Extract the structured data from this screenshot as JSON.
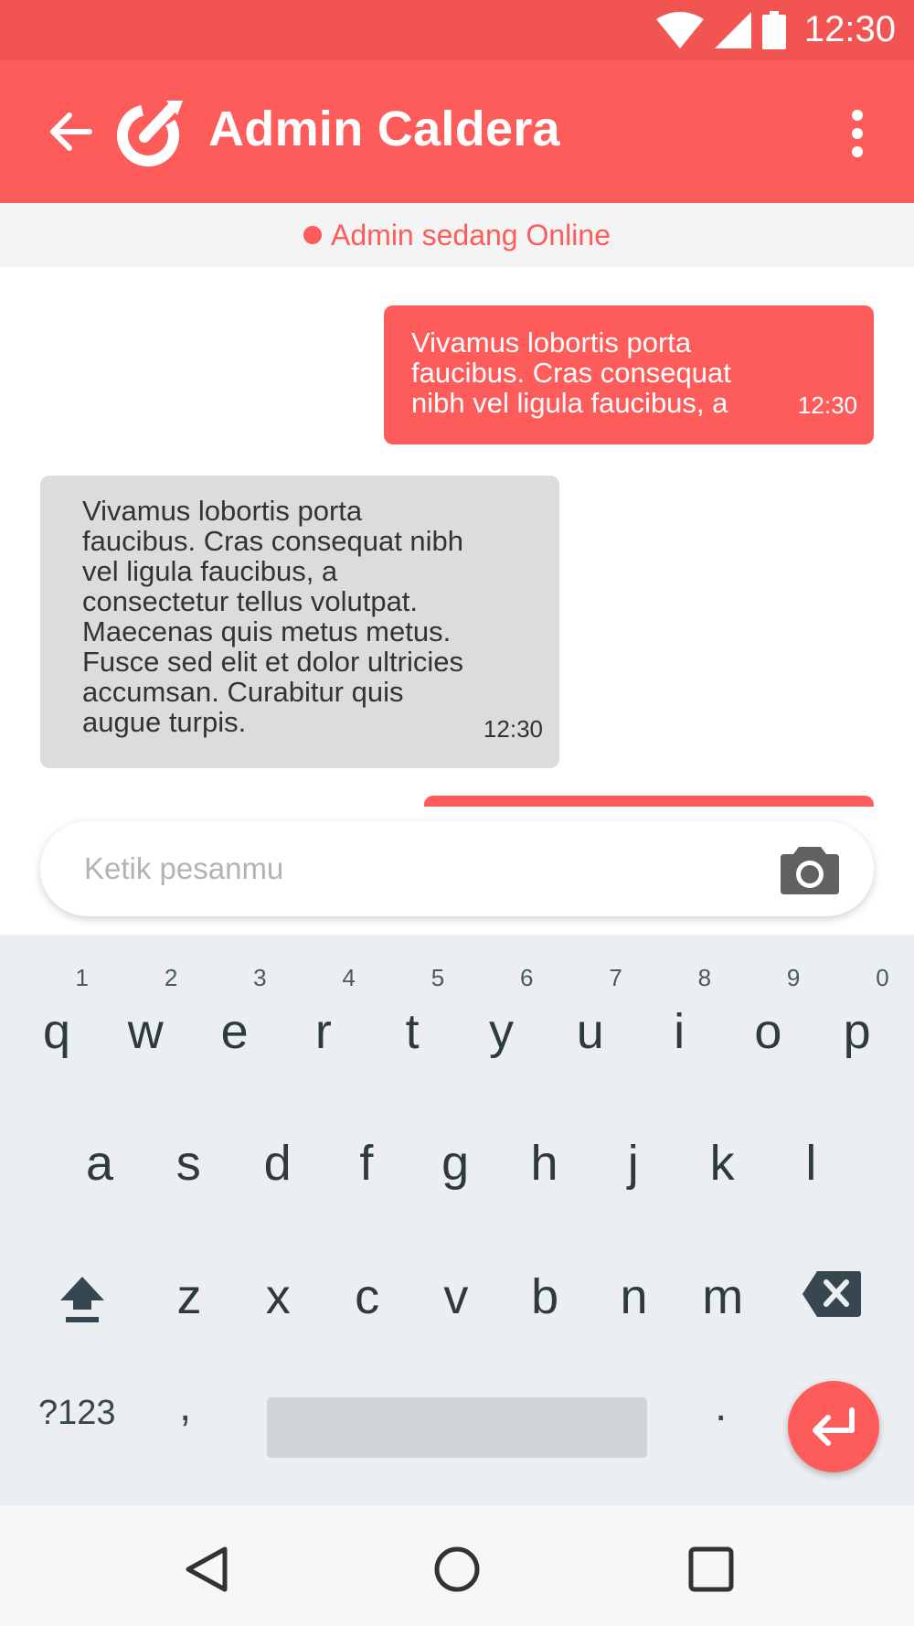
{
  "status_bar": {
    "time": "12:30",
    "icons": [
      "wifi-icon",
      "signal-icon",
      "battery-icon"
    ]
  },
  "app_bar": {
    "title": "Admin Caldera",
    "back_icon": "arrow-left-icon",
    "logo_icon": "caldera-logo-icon",
    "menu_icon": "more-vert-icon"
  },
  "online_status": {
    "label": "Admin sedang Online"
  },
  "messages": [
    {
      "direction": "outgoing",
      "text": "Vivamus lobortis porta faucibus. Cras consequat nibh vel ligula faucibus, a",
      "time": "12:30"
    },
    {
      "direction": "incoming",
      "text": "Vivamus lobortis porta faucibus. Cras consequat nibh vel ligula faucibus, a consectetur tellus volutpat. Maecenas quis metus metus. Fusce sed elit et dolor ultricies accumsan. Curabitur quis augue turpis.",
      "time": "12:30"
    }
  ],
  "composer": {
    "placeholder": "Ketik pesanmu",
    "camera_icon": "camera-icon"
  },
  "keyboard": {
    "row1": [
      {
        "key": "q",
        "hint": "1"
      },
      {
        "key": "w",
        "hint": "2"
      },
      {
        "key": "e",
        "hint": "3"
      },
      {
        "key": "r",
        "hint": "4"
      },
      {
        "key": "t",
        "hint": "5"
      },
      {
        "key": "y",
        "hint": "6"
      },
      {
        "key": "u",
        "hint": "7"
      },
      {
        "key": "i",
        "hint": "8"
      },
      {
        "key": "o",
        "hint": "9"
      },
      {
        "key": "p",
        "hint": "0"
      }
    ],
    "row2": [
      "a",
      "s",
      "d",
      "f",
      "g",
      "h",
      "j",
      "k",
      "l"
    ],
    "row3": [
      "z",
      "x",
      "c",
      "v",
      "b",
      "n",
      "m"
    ],
    "symbols_label": "?123",
    "comma_label": ",",
    "period_label": ".",
    "shift_icon": "shift-icon",
    "backspace_icon": "backspace-icon",
    "enter_icon": "enter-icon"
  },
  "nav_bar": {
    "icons": [
      "back-triangle-icon",
      "home-circle-icon",
      "recents-square-icon"
    ]
  },
  "colors": {
    "accent": "#fd5c5a",
    "status_bar": "#f25452",
    "incoming_bubble": "#dcdcdc",
    "keyboard_bg": "#eceff1"
  }
}
